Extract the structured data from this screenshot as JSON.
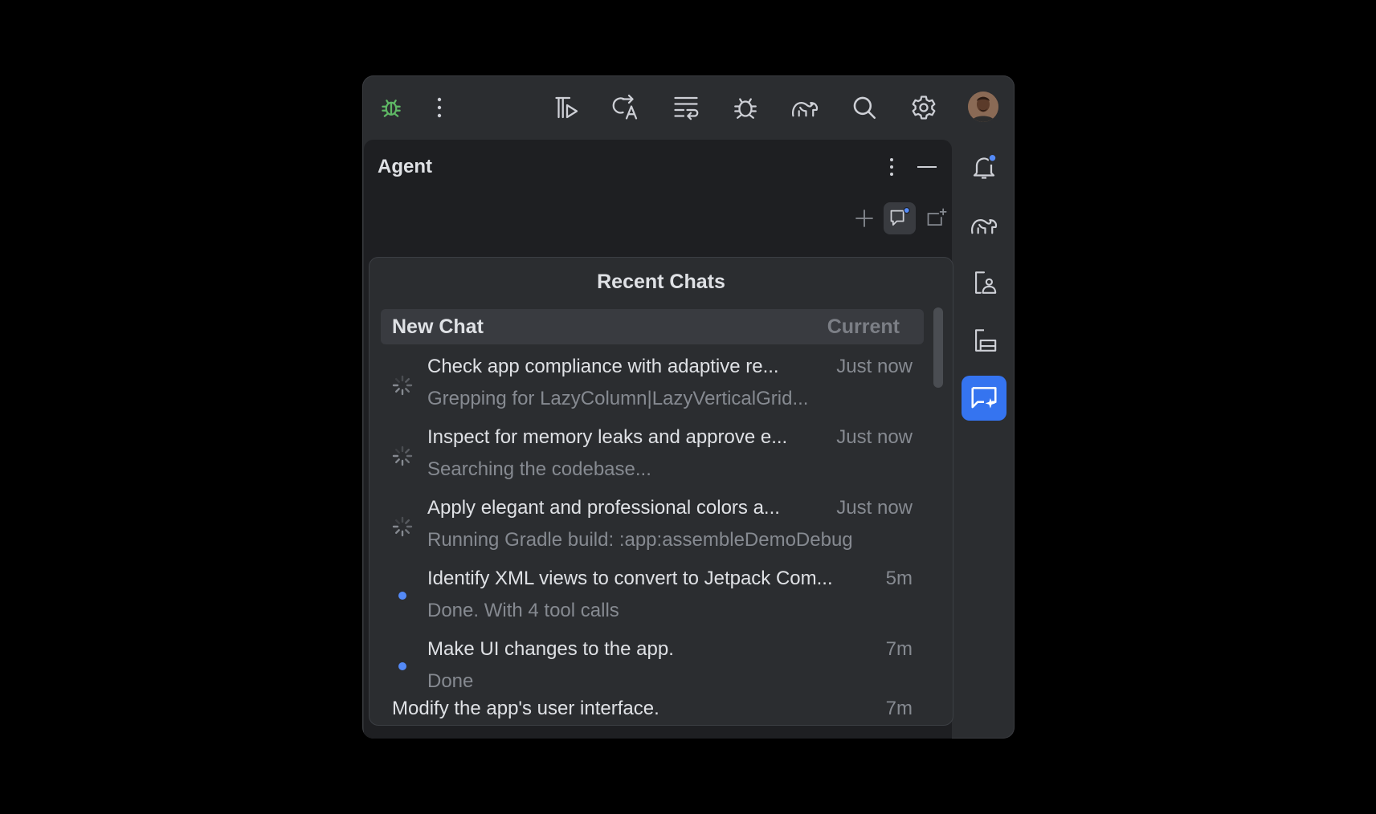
{
  "toolbar": {
    "icons": [
      "bug-icon",
      "more-vertical-icon",
      "run-tests-icon",
      "translate-icon",
      "wrap-lines-icon",
      "debug-icon",
      "gradle-elephant-icon",
      "search-icon",
      "settings-gear-icon",
      "user-avatar"
    ],
    "accent_green": "#5fb865"
  },
  "agent_panel": {
    "title": "Agent",
    "actions": [
      "more-vertical-icon",
      "minimize-icon",
      "plus-icon",
      "chat-history-icon",
      "new-tab-icon"
    ]
  },
  "recent_chats": {
    "title": "Recent Chats",
    "current": {
      "name": "New Chat",
      "badge": "Current"
    },
    "items": [
      {
        "title": "Check app compliance with adaptive re...",
        "subtitle": "Grepping for LazyColumn|LazyVerticalGrid...",
        "time": "Just now",
        "status": "running"
      },
      {
        "title": "Inspect for memory leaks and approve e...",
        "subtitle": "Searching the codebase...",
        "time": "Just now",
        "status": "running"
      },
      {
        "title": "Apply elegant and professional colors a...",
        "subtitle": "Running Gradle build: :app:assembleDemoDebug",
        "time": "Just now",
        "status": "running"
      },
      {
        "title": "Identify XML views to convert to Jetpack Com...",
        "subtitle": "Done. With 4 tool calls",
        "time": "5m",
        "status": "unread"
      },
      {
        "title": "Make UI changes to the app.",
        "subtitle": "Done",
        "time": "7m",
        "status": "unread"
      },
      {
        "title": "Modify the app's user interface.",
        "subtitle": "",
        "time": "7m",
        "status": "none"
      }
    ]
  },
  "right_strip": {
    "icons": [
      "notifications-bell-icon",
      "gradle-elephant-icon",
      "device-manager-icon",
      "running-devices-icon",
      "agent-chat-icon"
    ],
    "active_color": "#3574f0",
    "notification_dot_color": "#548af7"
  }
}
